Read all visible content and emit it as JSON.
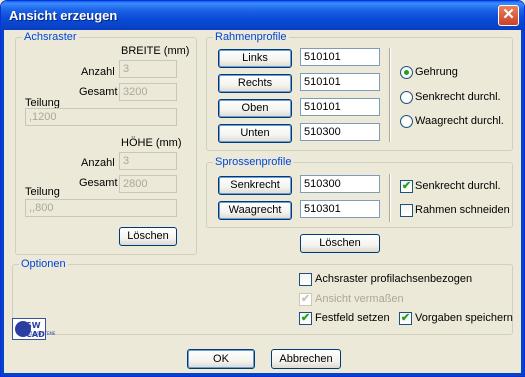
{
  "window": {
    "title": "Ansicht erzeugen"
  },
  "achsraster": {
    "legend": "Achsraster",
    "breite": {
      "header": "BREITE (mm)",
      "anzahl_label": "Anzahl",
      "anzahl": "3",
      "gesamt_label": "Gesamt",
      "gesamt": "3200",
      "teilung_label": "Teilung",
      "teilung": ",1200"
    },
    "hoehe": {
      "header": "HÖHE (mm)",
      "anzahl_label": "Anzahl",
      "anzahl": "3",
      "gesamt_label": "Gesamt",
      "gesamt": "2800",
      "teilung_label": "Teilung",
      "teilung": ",,800"
    },
    "clear_label": "Löschen"
  },
  "rahmenprofile": {
    "legend": "Rahmenprofile",
    "rows": [
      {
        "label": "Links",
        "value": "510101"
      },
      {
        "label": "Rechts",
        "value": "510101"
      },
      {
        "label": "Oben",
        "value": "510101"
      },
      {
        "label": "Unten",
        "value": "510300"
      }
    ],
    "options": [
      {
        "label": "Gehrung",
        "selected": true
      },
      {
        "label": "Senkrecht durchl.",
        "selected": false
      },
      {
        "label": "Waagrecht durchl.",
        "selected": false
      }
    ]
  },
  "sprossenprofile": {
    "legend": "Sprossenprofile",
    "rows": [
      {
        "label": "Senkrecht",
        "value": "510300"
      },
      {
        "label": "Waagrecht",
        "value": "510301"
      }
    ],
    "options": [
      {
        "label": "Senkrecht durchl.",
        "checked": true
      },
      {
        "label": "Rahmen schneiden",
        "checked": false
      }
    ],
    "clear_label": "Löschen"
  },
  "optionen": {
    "legend": "Optionen",
    "achsraster_label": "Achsraster profilachsenbezogen",
    "ansicht_label": "Ansicht vermaßen",
    "festfeld_label": "Festfeld setzen",
    "vorgaben_label": "Vorgaben speichern"
  },
  "footer": {
    "ok_label": "OK",
    "cancel_label": "Abbrechen",
    "logo_text": "SW CAD",
    "logo_sub": "ALLE SYSTEME"
  },
  "colors": {
    "accent": "#0046d5",
    "check": "#21a121",
    "title_bar": "#0a4bd8"
  }
}
